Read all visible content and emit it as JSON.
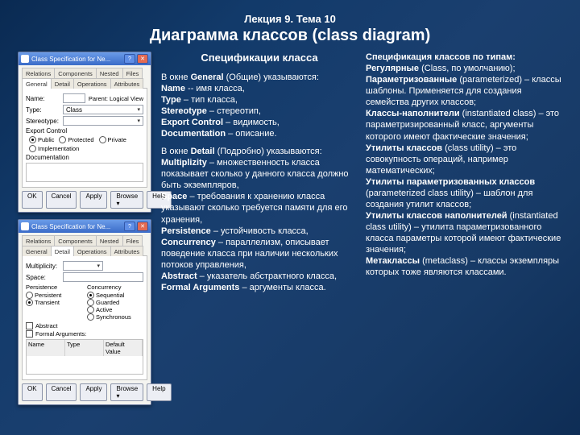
{
  "lecture": "Лекция 9. Тема 10",
  "title": "Диаграмма классов (class diagram)",
  "mid": {
    "heading": "Спецификации класса",
    "p1_intro": "В окне ",
    "p1_general": "General",
    "p1_general_ru": " (Общие) указываются:",
    "name_b": "Name",
    "name_t": " -- имя класса,",
    "type_b": "Type",
    "type_t": " – тип класса,",
    "stereo_b": "Stereotype",
    "stereo_t": " – стереотип,",
    "export_b": "Export Control",
    "export_t": " – видимость,",
    "doc_b": "Documentation",
    "doc_t": " – описание.",
    "p2_intro": "В окне ",
    "p2_detail": "Detail",
    "p2_detail_ru": " (Подробно) указываются:",
    "mult_b": "Multiplizity",
    "mult_t": " – множественность класса показывает сколько у данного класса должно быть экземпляров,",
    "space_b": "Space",
    "space_t": " – требования к хранению класса указывают сколько требуется памяти для его хранения,",
    "pers_b": "Persistence",
    "pers_t": " – устойчивость класса,",
    "conc_b": "Concurrency",
    "conc_t": " – параллелизм, описывает поведение класса при наличии нескольких потоков управления,",
    "abs_b": "Abstract",
    "abs_t": " – указатель абстрактного класса,",
    "fa_b": "Formal Arguments",
    "fa_t": " – аргументы класса."
  },
  "right": {
    "l1": "Спецификация классов по типам:",
    "reg_b": "Регулярные",
    "reg_t": " (Class, по умолчанию);",
    "par_b": "Параметризованные",
    "par_t": " (parameterized) – классы шаблоны. Применяется для создания семейства других классов;",
    "inst_b": "Классы-наполнители",
    "inst_t": " (instantiated class) – это параметризированный класс, аргументы которого имеют фактические значения;",
    "util_b": "Утилиты классов",
    "util_t": " (class utility) – это совокупность операций, например математических;",
    "putil_b": "Утилиты параметризованных классов",
    "putil_t": " (parameterized class utility)  – шаблон для создания утилит классов;",
    "iutil_b": "Утилиты классов наполнителей",
    "iutil_t": " (instantiated class utility) – утилита параметризованного класса параметры которой имеют фактические значения;",
    "meta_b": "Метаклассы",
    "meta_t": " (metaclass) – классы экземпляры которых тоже являются классами."
  },
  "win1": {
    "title": "Class Specification for Ne...",
    "tabs_r1": [
      "Relations",
      "Components",
      "Nested",
      "Files"
    ],
    "tabs_r2": [
      "General",
      "Detail",
      "Operations",
      "Attributes"
    ],
    "active": "General",
    "name_lbl": "Name:",
    "name_val": "",
    "parent_lbl": "Parent:",
    "parent_val": "Logical View",
    "type_lbl": "Type:",
    "type_val": "Class",
    "stereo_lbl": "Stereotype:",
    "stereo_val": "",
    "export_lbl": "Export Control",
    "radios": [
      "Public",
      "Protected",
      "Private",
      "Implementation"
    ],
    "doc_lbl": "Documentation",
    "buttons": [
      "OK",
      "Cancel",
      "Apply",
      "Browse ▾",
      "Help"
    ]
  },
  "win2": {
    "title": "Class Specification for Ne...",
    "tabs_r1": [
      "Relations",
      "Components",
      "Nested",
      "Files"
    ],
    "tabs_r2": [
      "General",
      "Detail",
      "Operations",
      "Attributes"
    ],
    "active": "Detail",
    "mult_lbl": "Multiplicity:",
    "mult_val": "",
    "space_lbl": "Space:",
    "space_val": "",
    "pers_lbl": "Persistence",
    "pers_opts": [
      "Persistent",
      "Transient"
    ],
    "pers_sel": "Transient",
    "conc_lbl": "Concurrency",
    "conc_opts": [
      "Sequential",
      "Guarded",
      "Active",
      "Synchronous"
    ],
    "conc_sel": "Sequential",
    "extras": [
      "Abstract",
      "Formal Arguments:"
    ],
    "tbl_hdr": [
      "Name",
      "Type",
      "Default Value"
    ],
    "buttons": [
      "OK",
      "Cancel",
      "Apply",
      "Browse ▾",
      "Help"
    ]
  }
}
